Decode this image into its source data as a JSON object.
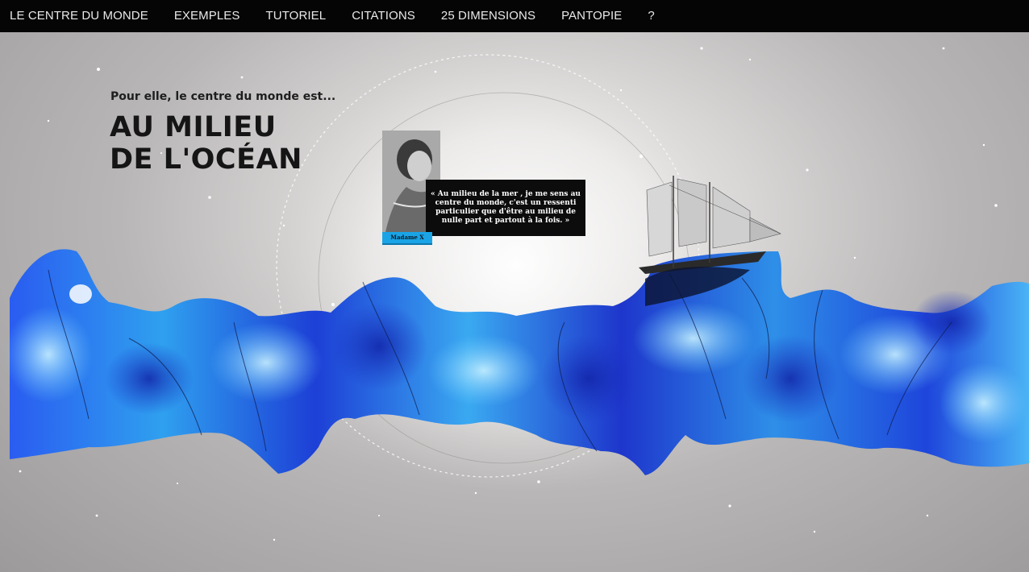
{
  "nav": {
    "items": [
      {
        "label": "LE CENTRE DU MONDE"
      },
      {
        "label": "EXEMPLES"
      },
      {
        "label": "TUTORIEL"
      },
      {
        "label": "CITATIONS"
      },
      {
        "label": "25 DIMENSIONS"
      },
      {
        "label": "PANTOPIE"
      },
      {
        "label": "?"
      }
    ]
  },
  "hero": {
    "subtitle": "Pour elle, le centre du monde est...",
    "title_line1": "AU MILIEU",
    "title_line2": "DE L'OCÉAN"
  },
  "quote": {
    "text": "« Au milieu de la mer , je me sens au centre du monde, c'est un ressenti particulier que d'être au milieu de nulle part et partout à la fois. »",
    "author": "Madame X"
  },
  "colors": {
    "nav_background": "#050505",
    "ocean_deep": "#1f3fd8",
    "ocean_light": "#33b6f2",
    "author_tag": "#1aa4e6"
  },
  "icons": {
    "ship": "sailing-ship-illustration",
    "portrait": "woman-portrait-photo"
  }
}
